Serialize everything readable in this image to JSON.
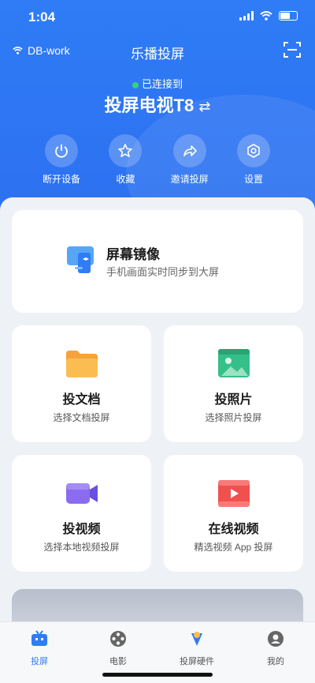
{
  "status_bar": {
    "time": "1:04"
  },
  "header": {
    "wifi_name": "DB-work",
    "title": "乐播投屏",
    "connection_status": "已连接到",
    "device_name": "投屏电视T8",
    "swap_symbol": "⇄"
  },
  "actions": [
    {
      "label": "断开设备",
      "icon": "power-icon"
    },
    {
      "label": "收藏",
      "icon": "star-icon"
    },
    {
      "label": "邀请投屏",
      "icon": "share-icon"
    },
    {
      "label": "设置",
      "icon": "gear-icon"
    }
  ],
  "mirror_card": {
    "title": "屏幕镜像",
    "subtitle": "手机画面实时同步到大屏"
  },
  "features": [
    {
      "title": "投文档",
      "subtitle": "选择文档投屏",
      "icon": "folder-icon",
      "color": "#f7a23a"
    },
    {
      "title": "投照片",
      "subtitle": "选择照片投屏",
      "icon": "photo-icon",
      "color": "#35c08a"
    },
    {
      "title": "投视频",
      "subtitle": "选择本地视频投屏",
      "icon": "video-camera-icon",
      "color": "#8a6cf0"
    },
    {
      "title": "在线视频",
      "subtitle": "精选视频 App 投屏",
      "icon": "film-icon",
      "color": "#f0504e"
    }
  ],
  "nav": [
    {
      "label": "投屏",
      "icon": "tv-icon",
      "active": true
    },
    {
      "label": "电影",
      "icon": "film-reel-icon",
      "active": false
    },
    {
      "label": "投屏硬件",
      "icon": "hardware-icon",
      "active": false
    },
    {
      "label": "我的",
      "icon": "profile-icon",
      "active": false
    }
  ],
  "colors": {
    "primary": "#2f7cf6",
    "connected": "#34d27b"
  }
}
